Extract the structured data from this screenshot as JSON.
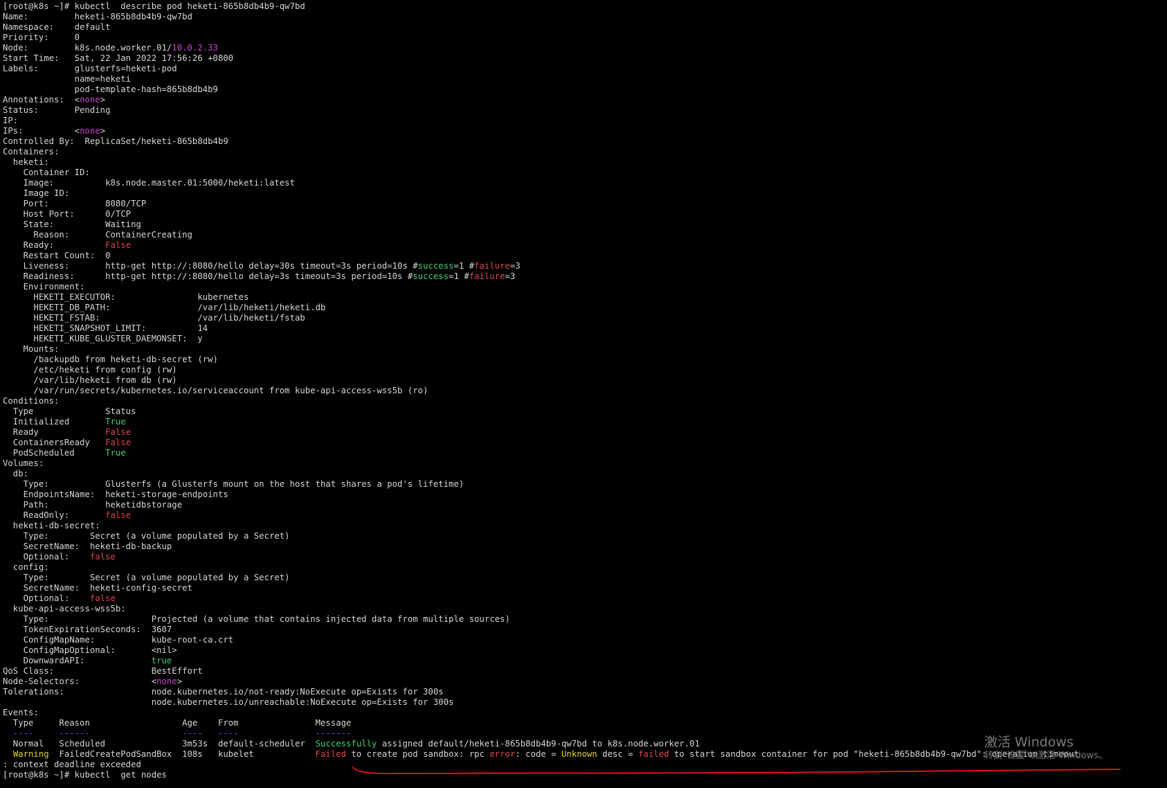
{
  "terminal": {
    "lines": [
      [
        {
          "t": "[root@k8s ~]# kubectl  describe pod heketi-865b8db4b9-qw7bd"
        }
      ],
      [
        {
          "t": "Name:         heketi-865b8db4b9-qw7bd"
        }
      ],
      [
        {
          "t": "Namespace:    default"
        }
      ],
      [
        {
          "t": "Priority:     0"
        }
      ],
      [
        {
          "t": "Node:         k8s.node.worker.01/"
        },
        {
          "t": "10.0.2.33",
          "c": "magenta"
        }
      ],
      [
        {
          "t": "Start Time:   Sat, 22 Jan 2022 17:56:26 +0800"
        }
      ],
      [
        {
          "t": "Labels:       glusterfs=heketi-pod"
        }
      ],
      [
        {
          "t": "              name=heketi"
        }
      ],
      [
        {
          "t": "              pod-template-hash=865b8db4b9"
        }
      ],
      [
        {
          "t": "Annotations:  <"
        },
        {
          "t": "none",
          "c": "magenta"
        },
        {
          "t": ">"
        }
      ],
      [
        {
          "t": "Status:       Pending"
        }
      ],
      [
        {
          "t": "IP:"
        }
      ],
      [
        {
          "t": "IPs:          <"
        },
        {
          "t": "none",
          "c": "magenta"
        },
        {
          "t": ">"
        }
      ],
      [
        {
          "t": "Controlled By:  ReplicaSet/heketi-865b8db4b9"
        }
      ],
      [
        {
          "t": "Containers:"
        }
      ],
      [
        {
          "t": "  heketi:"
        }
      ],
      [
        {
          "t": "    Container ID:"
        }
      ],
      [
        {
          "t": "    Image:          k8s.node.master.01:5000/heketi:latest"
        }
      ],
      [
        {
          "t": "    Image ID:"
        }
      ],
      [
        {
          "t": "    Port:           8080/TCP"
        }
      ],
      [
        {
          "t": "    Host Port:      0/TCP"
        }
      ],
      [
        {
          "t": "    State:          Waiting"
        }
      ],
      [
        {
          "t": "      Reason:       ContainerCreating"
        }
      ],
      [
        {
          "t": "    Ready:          "
        },
        {
          "t": "False",
          "c": "red"
        }
      ],
      [
        {
          "t": "    Restart Count:  0"
        }
      ],
      [
        {
          "t": "    Liveness:       http-get http://:8080/hello delay=30s timeout=3s period=10s #"
        },
        {
          "t": "success",
          "c": "green"
        },
        {
          "t": "=1 #"
        },
        {
          "t": "failure",
          "c": "red"
        },
        {
          "t": "=3"
        }
      ],
      [
        {
          "t": "    Readiness:      http-get http://:8080/hello delay=3s timeout=3s period=10s #"
        },
        {
          "t": "success",
          "c": "green"
        },
        {
          "t": "=1 #"
        },
        {
          "t": "failure",
          "c": "red"
        },
        {
          "t": "=3"
        }
      ],
      [
        {
          "t": "    Environment:"
        }
      ],
      [
        {
          "t": "      HEKETI_EXECUTOR:                kubernetes"
        }
      ],
      [
        {
          "t": "      HEKETI_DB_PATH:                 /var/lib/heketi/heketi.db"
        }
      ],
      [
        {
          "t": "      HEKETI_FSTAB:                   /var/lib/heketi/fstab"
        }
      ],
      [
        {
          "t": "      HEKETI_SNAPSHOT_LIMIT:          14"
        }
      ],
      [
        {
          "t": "      HEKETI_KUBE_GLUSTER_DAEMONSET:  y"
        }
      ],
      [
        {
          "t": "    Mounts:"
        }
      ],
      [
        {
          "t": "      /backupdb from heketi-db-secret (rw)"
        }
      ],
      [
        {
          "t": "      /etc/heketi from config (rw)"
        }
      ],
      [
        {
          "t": "      /var/lib/heketi from db (rw)"
        }
      ],
      [
        {
          "t": "      /var/run/secrets/kubernetes.io/serviceaccount from kube-api-access-wss5b (ro)"
        }
      ],
      [
        {
          "t": "Conditions:"
        }
      ],
      [
        {
          "t": "  Type              Status"
        }
      ],
      [
        {
          "t": "  Initialized       "
        },
        {
          "t": "True",
          "c": "green"
        }
      ],
      [
        {
          "t": "  Ready             "
        },
        {
          "t": "False",
          "c": "red"
        }
      ],
      [
        {
          "t": "  ContainersReady   "
        },
        {
          "t": "False",
          "c": "red"
        }
      ],
      [
        {
          "t": "  PodScheduled      "
        },
        {
          "t": "True",
          "c": "green"
        }
      ],
      [
        {
          "t": "Volumes:"
        }
      ],
      [
        {
          "t": "  db:"
        }
      ],
      [
        {
          "t": "    Type:           Glusterfs (a Glusterfs mount on the host that shares a pod's lifetime)"
        }
      ],
      [
        {
          "t": "    EndpointsName:  heketi-storage-endpoints"
        }
      ],
      [
        {
          "t": "    Path:           heketidbstorage"
        }
      ],
      [
        {
          "t": "    ReadOnly:       "
        },
        {
          "t": "false",
          "c": "red"
        }
      ],
      [
        {
          "t": "  heketi-db-secret:"
        }
      ],
      [
        {
          "t": "    Type:        Secret (a volume populated by a Secret)"
        }
      ],
      [
        {
          "t": "    SecretName:  heketi-db-backup"
        }
      ],
      [
        {
          "t": "    Optional:    "
        },
        {
          "t": "false",
          "c": "red"
        }
      ],
      [
        {
          "t": "  config:"
        }
      ],
      [
        {
          "t": "    Type:        Secret (a volume populated by a Secret)"
        }
      ],
      [
        {
          "t": "    SecretName:  heketi-config-secret"
        }
      ],
      [
        {
          "t": "    Optional:    "
        },
        {
          "t": "false",
          "c": "red"
        }
      ],
      [
        {
          "t": "  kube-api-access-wss5b:"
        }
      ],
      [
        {
          "t": "    Type:                    Projected (a volume that contains injected data from multiple sources)"
        }
      ],
      [
        {
          "t": "    TokenExpirationSeconds:  3607"
        }
      ],
      [
        {
          "t": "    ConfigMapName:           kube-root-ca.crt"
        }
      ],
      [
        {
          "t": "    ConfigMapOptional:       <nil>"
        }
      ],
      [
        {
          "t": "    DownwardAPI:             "
        },
        {
          "t": "true",
          "c": "green"
        }
      ],
      [
        {
          "t": "QoS Class:                   BestEffort"
        }
      ],
      [
        {
          "t": "Node-Selectors:              <"
        },
        {
          "t": "none",
          "c": "magenta"
        },
        {
          "t": ">"
        }
      ],
      [
        {
          "t": "Tolerations:                 node.kubernetes.io/not-ready:NoExecute op=Exists for 300s"
        }
      ],
      [
        {
          "t": "                             node.kubernetes.io/unreachable:NoExecute op=Exists for 300s"
        }
      ],
      [
        {
          "t": "Events:"
        }
      ],
      [
        {
          "t": "  Type     Reason                  Age    From               Message"
        }
      ],
      [
        {
          "t": "  ----     ------                  ----   ----               -------",
          "c": "blue"
        }
      ],
      [
        {
          "t": "  Normal   Scheduled               3m53s  default-scheduler  "
        },
        {
          "t": "Successfully",
          "c": "green"
        },
        {
          "t": " assigned default/heketi-865b8db4b9-qw7bd to k8s.node.worker.01"
        }
      ],
      [
        {
          "t": "  "
        },
        {
          "t": "Warning",
          "c": "yellow"
        },
        {
          "t": "  FailedCreatePodSandBox  108s   kubelet            "
        },
        {
          "t": "Failed",
          "c": "red"
        },
        {
          "t": " to create pod sandbox: rpc "
        },
        {
          "t": "error",
          "c": "red"
        },
        {
          "t": ": code = "
        },
        {
          "t": "Unknown",
          "c": "yellow"
        },
        {
          "t": " desc = "
        },
        {
          "t": "failed",
          "c": "red"
        },
        {
          "t": " to start sandbox container for pod \"heketi-865b8db4b9-qw7bd\": operation timeout"
        }
      ],
      [
        {
          "t": ": context deadline exceeded"
        }
      ],
      [
        {
          "t": "[root@k8s ~]# kubectl  get nodes"
        }
      ]
    ]
  },
  "watermark": {
    "title": "激活 Windows",
    "subtitle": "转到\"设置\"以激活 Windows。"
  },
  "annotation": {
    "underline_color": "#e0101a"
  }
}
